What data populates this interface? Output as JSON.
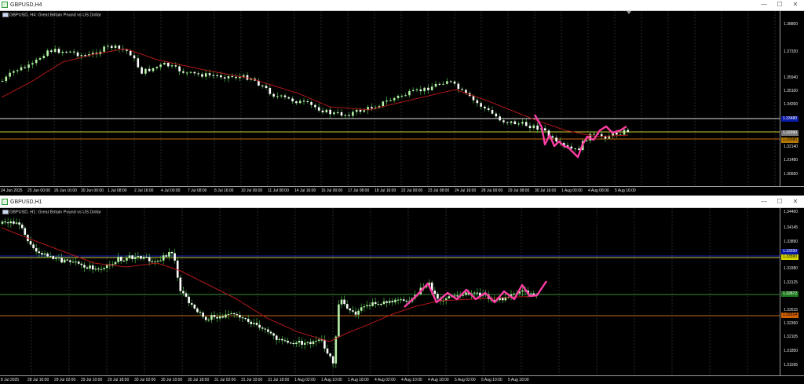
{
  "top": {
    "title": "GBPUSD,H4",
    "symbol_label": "GBPUSD, H4:  Great Britain Pound vs US Dollar",
    "price_ticks": [
      "1.38800",
      "1.37320",
      "1.35940",
      "1.34260",
      "1.35100",
      "1.32140",
      "1.31480",
      "1.30660"
    ],
    "price_tags": [
      {
        "text": "1.33480",
        "bg": "#0a1aa8",
        "fg": "#ffffff"
      },
      {
        "text": "1.32990",
        "bg": "#7a7a7a",
        "fg": "#ffffff"
      },
      {
        "text": "1.32680",
        "bg": "#b47a00",
        "fg": "#000000"
      }
    ],
    "time_labels": [
      "24 Jun 2025",
      "25 Jun 00:00",
      "26 Jun 16:00",
      "30 Jun 00:00",
      "1 Jul 08:00",
      "2 Jul 16:00",
      "4 Jul 00:00",
      "7 Jul 08:00",
      "8 Jul 16:00",
      "10 Jul 00:00",
      "11 Jul 08:00",
      "14 Jul 16:00",
      "16 Jul 00:00",
      "17 Jul 08:00",
      "18 Jul 16:00",
      "22 Jul 00:00",
      "23 Jul 08:00",
      "24 Jul 16:00",
      "28 Jul 00:00",
      "29 Jul 08:00",
      "30 Jul 16:00",
      "1 Aug 00:00",
      "4 Aug 08:00",
      "5 Aug 16:00"
    ]
  },
  "bottom": {
    "title": "GBPUSD,H1",
    "symbol_label": "GBPUSD, H1:  Great Britain Pound vs US Dollar",
    "price_ticks": [
      "1.34400",
      "1.34145",
      "1.33890",
      "1.33380",
      "1.33125",
      "1.32615",
      "1.32360",
      "1.32105",
      "1.31850",
      "1.31595"
    ],
    "price_tags": [
      {
        "text": "1.33590",
        "bg": "#0a1aa8",
        "fg": "#ffffff"
      },
      {
        "text": "1.33590",
        "bg": "#d4d400",
        "fg": "#000000"
      },
      {
        "text": "1.32872",
        "bg": "#1f7a1f",
        "fg": "#ffffff"
      },
      {
        "text": "1.32614",
        "bg": "#d06000",
        "fg": "#000000"
      }
    ],
    "time_labels": [
      "8 Jul 2025",
      "28 Jul 16:00",
      "29 Jul 02:00",
      "29 Jul 10:00",
      "29 Jul 18:00",
      "30 Jul 02:00",
      "30 Jul 10:00",
      "30 Jul 18:00",
      "31 Jul 02:00",
      "31 Jul 10:00",
      "31 Jul 18:00",
      "1 Aug 02:00",
      "1 Aug 10:00",
      "1 Aug 18:00",
      "4 Aug 02:00",
      "4 Aug 10:00",
      "4 Aug 18:00",
      "5 Aug 02:00",
      "5 Aug 10:00",
      "5 Aug 18:00"
    ]
  },
  "colors": {
    "bull": "#b8f2a8",
    "bear": "#ffffff",
    "wick": "#3fa63f",
    "ma": "#b21818",
    "projection": "#ff3ea5",
    "h_white": "#e0e0e0",
    "h_yellow": "#cccc33",
    "h_orange": "#c86a10",
    "h_green": "#2e8b2e",
    "h_blue": "#1a2ac0"
  },
  "window_buttons": {
    "minimize": "—",
    "maximize": "☐",
    "close": "✕"
  }
}
